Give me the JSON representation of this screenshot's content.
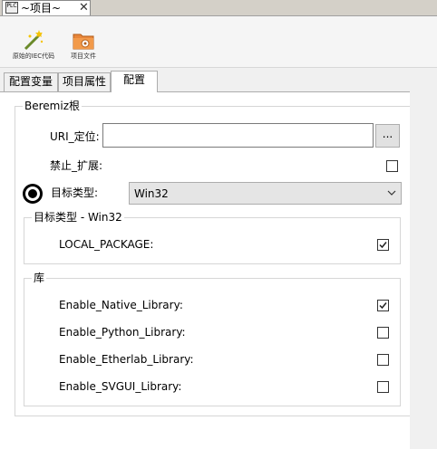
{
  "doc_tab": {
    "icon_text": "PLC",
    "title": "~项目~",
    "close": "✕"
  },
  "toolbar": {
    "items": [
      {
        "label": "原始的IEC代码",
        "icon": "wand-icon"
      },
      {
        "label": "项目文件",
        "icon": "folder-gear-icon"
      }
    ]
  },
  "tabs": [
    {
      "label": "配置变量",
      "active": false
    },
    {
      "label": "项目属性",
      "active": false
    },
    {
      "label": "配置",
      "active": true
    }
  ],
  "config": {
    "beremiz_group": "Beremiz根",
    "uri_label": "URI_定位:",
    "uri_value": "",
    "browse_label": "...",
    "disable_ext_label": "禁止_扩展:",
    "disable_ext_checked": false,
    "target_type_label": "目标类型:",
    "target_type_value": "Win32",
    "target_group": "目标类型 - Win32",
    "local_package_label": "LOCAL_PACKAGE:",
    "local_package_checked": true,
    "library_group": "库",
    "libraries": [
      {
        "label": "Enable_Native_Library:",
        "checked": true
      },
      {
        "label": "Enable_Python_Library:",
        "checked": false
      },
      {
        "label": "Enable_Etherlab_Library:",
        "checked": false
      },
      {
        "label": "Enable_SVGUI_Library:",
        "checked": false
      }
    ]
  }
}
